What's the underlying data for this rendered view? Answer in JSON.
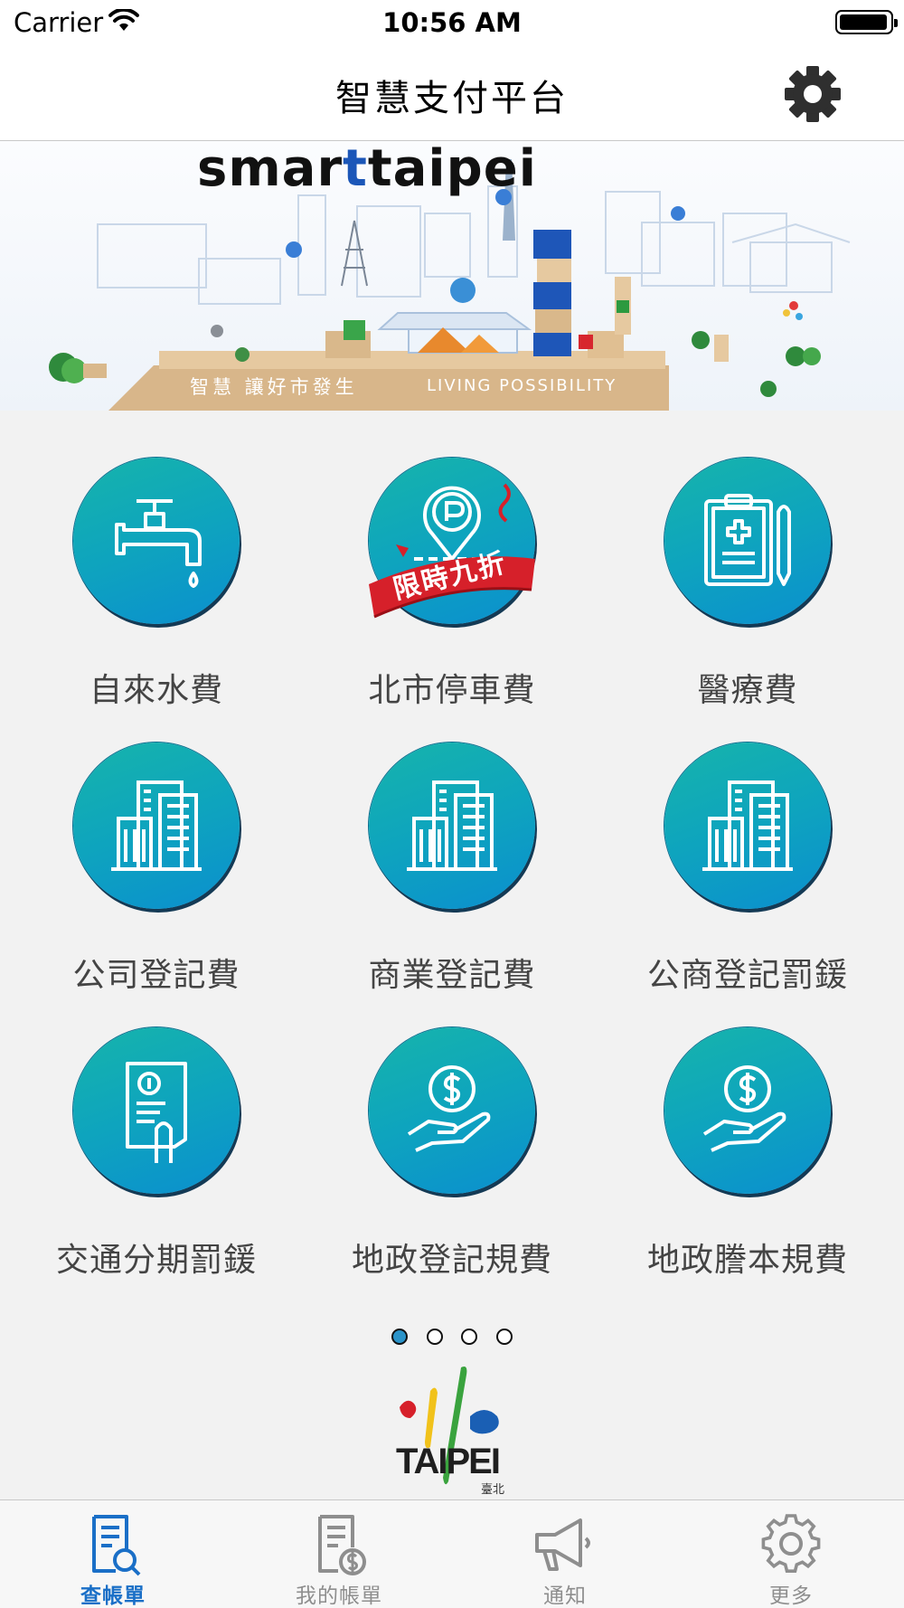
{
  "status_bar": {
    "carrier": "Carrier",
    "time": "10:56 AM"
  },
  "nav": {
    "title": "智慧支付平台",
    "settings_icon": "gear-icon"
  },
  "banner": {
    "logo_prefix": "smar",
    "logo_t": "t",
    "logo_suffix": "taipei",
    "slogan_zh": "智慧  讓好市發生",
    "slogan_en": "LIVING POSSIBILITY"
  },
  "services": [
    {
      "label": "自來水費",
      "icon": "water-faucet-icon"
    },
    {
      "label": "北市停車費",
      "icon": "parking-location-icon",
      "badge": "限時九折"
    },
    {
      "label": "醫療費",
      "icon": "medical-clipboard-icon"
    },
    {
      "label": "公司登記費",
      "icon": "office-building-icon"
    },
    {
      "label": "商業登記費",
      "icon": "office-building-icon"
    },
    {
      "label": "公商登記罰鍰",
      "icon": "office-building-icon"
    },
    {
      "label": "交通分期罰鍰",
      "icon": "bill-receipt-icon"
    },
    {
      "label": "地政登記規費",
      "icon": "hand-coin-icon"
    },
    {
      "label": "地政謄本規費",
      "icon": "hand-coin-icon"
    }
  ],
  "pager": {
    "page_count": 4,
    "active_page": 1
  },
  "footer_logo": {
    "text": "TAIPEI",
    "sub": "臺北"
  },
  "tabs": [
    {
      "label": "查帳單",
      "icon": "bill-search-icon",
      "active": true
    },
    {
      "label": "我的帳單",
      "icon": "my-bill-icon",
      "active": false
    },
    {
      "label": "通知",
      "icon": "megaphone-icon",
      "active": false
    },
    {
      "label": "更多",
      "icon": "gear-icon",
      "active": false
    }
  ],
  "colors": {
    "accent": "#1a6fc7",
    "circle_top": "#16b4ab",
    "circle_bottom": "#0b8fcf",
    "badge_red": "#d6202a"
  }
}
